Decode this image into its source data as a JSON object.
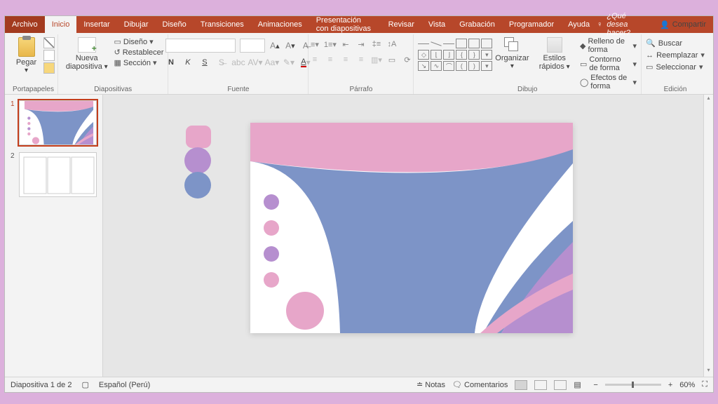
{
  "tabs": {
    "file": "Archivo",
    "home": "Inicio",
    "insert": "Insertar",
    "draw": "Dibujar",
    "design": "Diseño",
    "transitions": "Transiciones",
    "animations": "Animaciones",
    "slideshow": "Presentación con diapositivas",
    "review": "Revisar",
    "view": "Vista",
    "recording": "Grabación",
    "developer": "Programador",
    "help": "Ayuda",
    "tell_me": "¿Qué desea hacer?",
    "share": "Compartir"
  },
  "ribbon": {
    "clipboard": {
      "label": "Portapapeles",
      "paste": "Pegar"
    },
    "slides": {
      "label": "Diapositivas",
      "new_slide": "Nueva diapositiva",
      "layout": "Diseño",
      "reset": "Restablecer",
      "section": "Sección"
    },
    "font": {
      "label": "Fuente"
    },
    "paragraph": {
      "label": "Párrafo"
    },
    "drawing": {
      "label": "Dibujo",
      "arrange": "Organizar",
      "quick_styles": "Estilos rápidos",
      "shape_fill": "Relleno de forma",
      "shape_outline": "Contorno de forma",
      "shape_effects": "Efectos de forma"
    },
    "editing": {
      "label": "Edición",
      "find": "Buscar",
      "replace": "Reemplazar",
      "select": "Seleccionar"
    }
  },
  "thumbs": {
    "n1": "1",
    "n2": "2"
  },
  "status": {
    "slide_of": "Diapositiva 1 de 2",
    "lang": "Español (Perú)",
    "notes": "Notas",
    "comments": "Comentarios",
    "zoom": "60%"
  },
  "palette": {
    "pink": "#e7a6c9",
    "lilac": "#b68fcf",
    "blue": "#7d94c7"
  }
}
